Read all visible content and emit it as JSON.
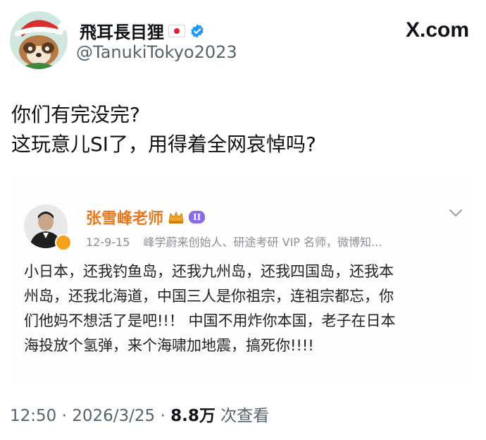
{
  "author": {
    "display_name": "飛耳長目狸",
    "flag_icon": "japan-flag-icon",
    "verified_icon": "verified-badge-icon",
    "handle": "@TanukiTokyo2023",
    "avatar_icon": "tanuki-santa-avatar"
  },
  "brand": {
    "label": "X.com"
  },
  "tweet": {
    "lines": [
      "你们有完没完?",
      "这玩意儿SI了，用得着全网哀悼吗?"
    ]
  },
  "quoted_post": {
    "author_name": "张雪峰老师",
    "level_badge": "II",
    "crown_icon": "crown-icon",
    "verified_color": "#f4a21b",
    "name_color": "#e8781d",
    "date": "12-9-15",
    "bio": "峰学蔚来创始人、研途考研 VIP 名师，微博知...",
    "body_lines": [
      "小日本，还我钓鱼岛，还我九州岛，还我四国岛，还我本",
      "州岛，还我北海道，中国三人是你祖宗，连祖宗都忘，你",
      "们他妈不想活了是吧!!！ 中国不用炸你本国，老子在日本",
      "海投放个氢弹，来个海啸加地震，搞死你!!!!"
    ],
    "more_icon": "chevron-down-icon"
  },
  "footer": {
    "time": "12:50",
    "separator": "·",
    "date": "2026/3/25",
    "views": "8.8万",
    "views_label": "次查看"
  }
}
